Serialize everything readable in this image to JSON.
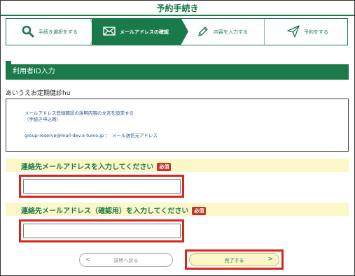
{
  "page": {
    "title": "予約手続き"
  },
  "steps": [
    {
      "label": "手続き選択をする",
      "icon": "search-icon"
    },
    {
      "label": "メールアドレスの確認",
      "icon": "envelope-icon"
    },
    {
      "label": "内容を入力する",
      "icon": "pencil-icon"
    },
    {
      "label": "予約をする",
      "icon": "paper-plane-icon"
    }
  ],
  "section": {
    "title": "利用者ID入力"
  },
  "user_id_text": "あいうえお定期健診hu",
  "info": {
    "description_line1": "メールアドレス登録確認の説明内容の文言を設定する",
    "description_line2": "（手続き申込時）",
    "sender_address": "group-reserve@mail-dev.e-tumo.jp ：　メール送信元アドレス"
  },
  "email_field": {
    "label": "連絡先メールアドレスを入力してください",
    "required_badge": "必須",
    "value": ""
  },
  "email_confirm_field": {
    "label": "連絡先メールアドレス（確認用）を入力してください",
    "required_badge": "必須",
    "value": ""
  },
  "buttons": {
    "back_label": "説明へ戻る",
    "back_chevron": "<",
    "submit_label": "完了する",
    "submit_chevron": ">"
  },
  "colors": {
    "brand_green": "#1a7a4a",
    "highlight_red": "#d9261c",
    "required_red": "#c0362c",
    "field_band_yellow": "#fbf7c8",
    "link_blue": "#1a4f9a"
  }
}
